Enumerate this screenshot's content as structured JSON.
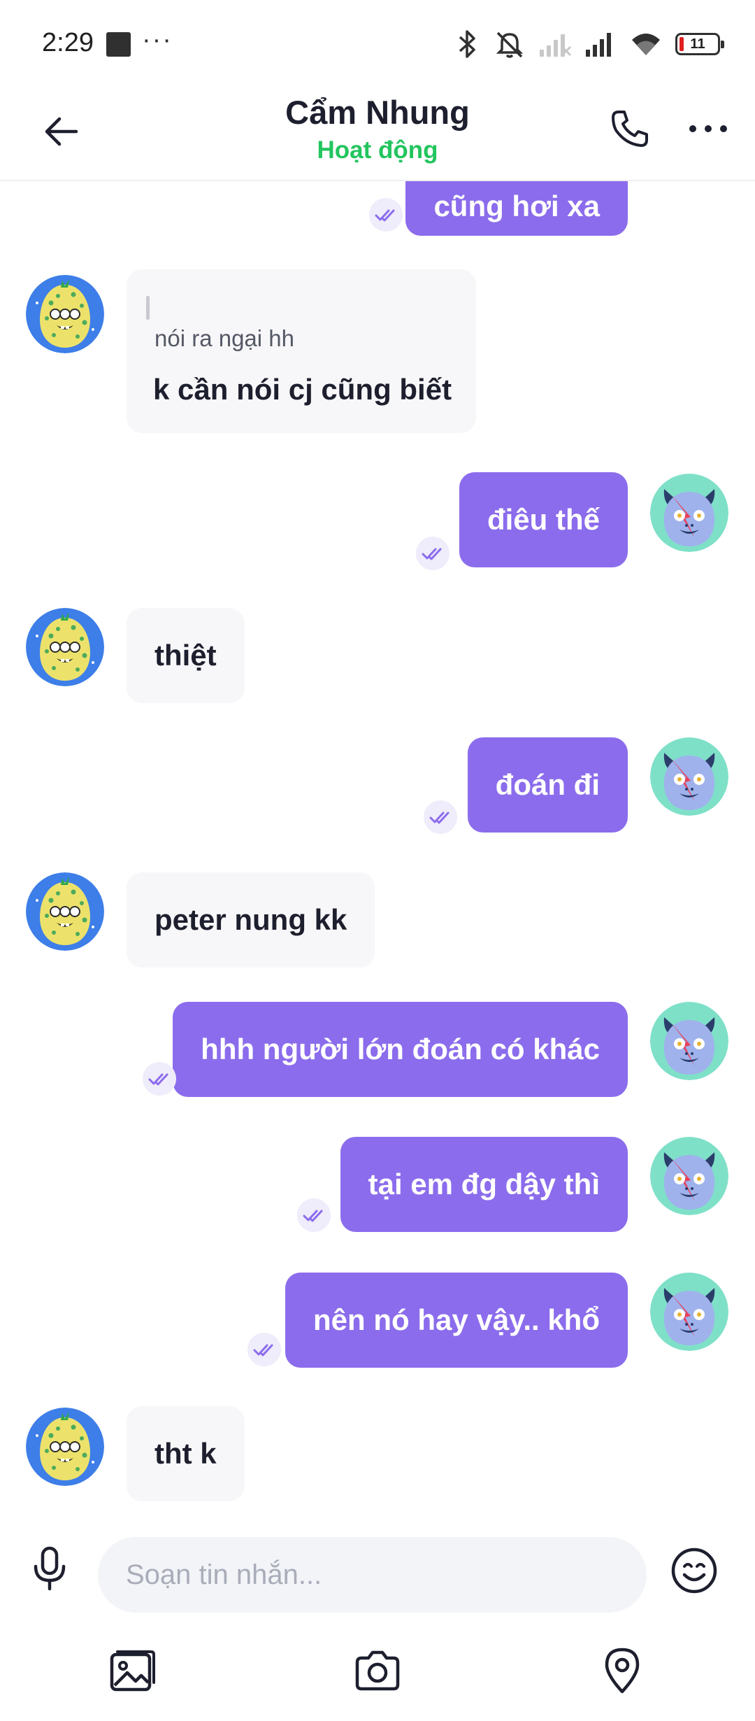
{
  "status": {
    "time": "2:29",
    "dots": "···",
    "battery": "11"
  },
  "header": {
    "name": "Cẩm Nhung",
    "presence": "Hoạt động"
  },
  "messages": [
    {
      "dir": "out",
      "text": "cũng hơi xa"
    },
    {
      "dir": "in",
      "quote": "nói ra ngại hh",
      "text": "k cần nói cj cũng biết"
    },
    {
      "dir": "out",
      "text": "điêu thế"
    },
    {
      "dir": "in",
      "text": "thiệt"
    },
    {
      "dir": "out",
      "text": "đoán đi"
    },
    {
      "dir": "in",
      "text": "peter nung kk"
    },
    {
      "dir": "out",
      "text": "hhh người lớn đoán có khác"
    },
    {
      "dir": "out",
      "text": "tại em đg dậy thì"
    },
    {
      "dir": "out",
      "text": "nên nó hay vậy.. khổ"
    },
    {
      "dir": "in",
      "text": "tht k"
    }
  ],
  "composer": {
    "placeholder": "Soạn tin nhắn..."
  },
  "icons": {
    "back": "arrow-left-icon",
    "call": "phone-icon",
    "more": "more-horizontal-icon",
    "mic": "microphone-icon",
    "emoji": "smiley-icon",
    "gallery": "image-icon",
    "camera": "camera-icon",
    "location": "map-pin-icon",
    "seen": "double-check-icon"
  },
  "colors": {
    "accent": "#8b6cec",
    "online": "#22c55e",
    "incoming_bg": "#f7f7f9",
    "text": "#1d1f2e"
  }
}
